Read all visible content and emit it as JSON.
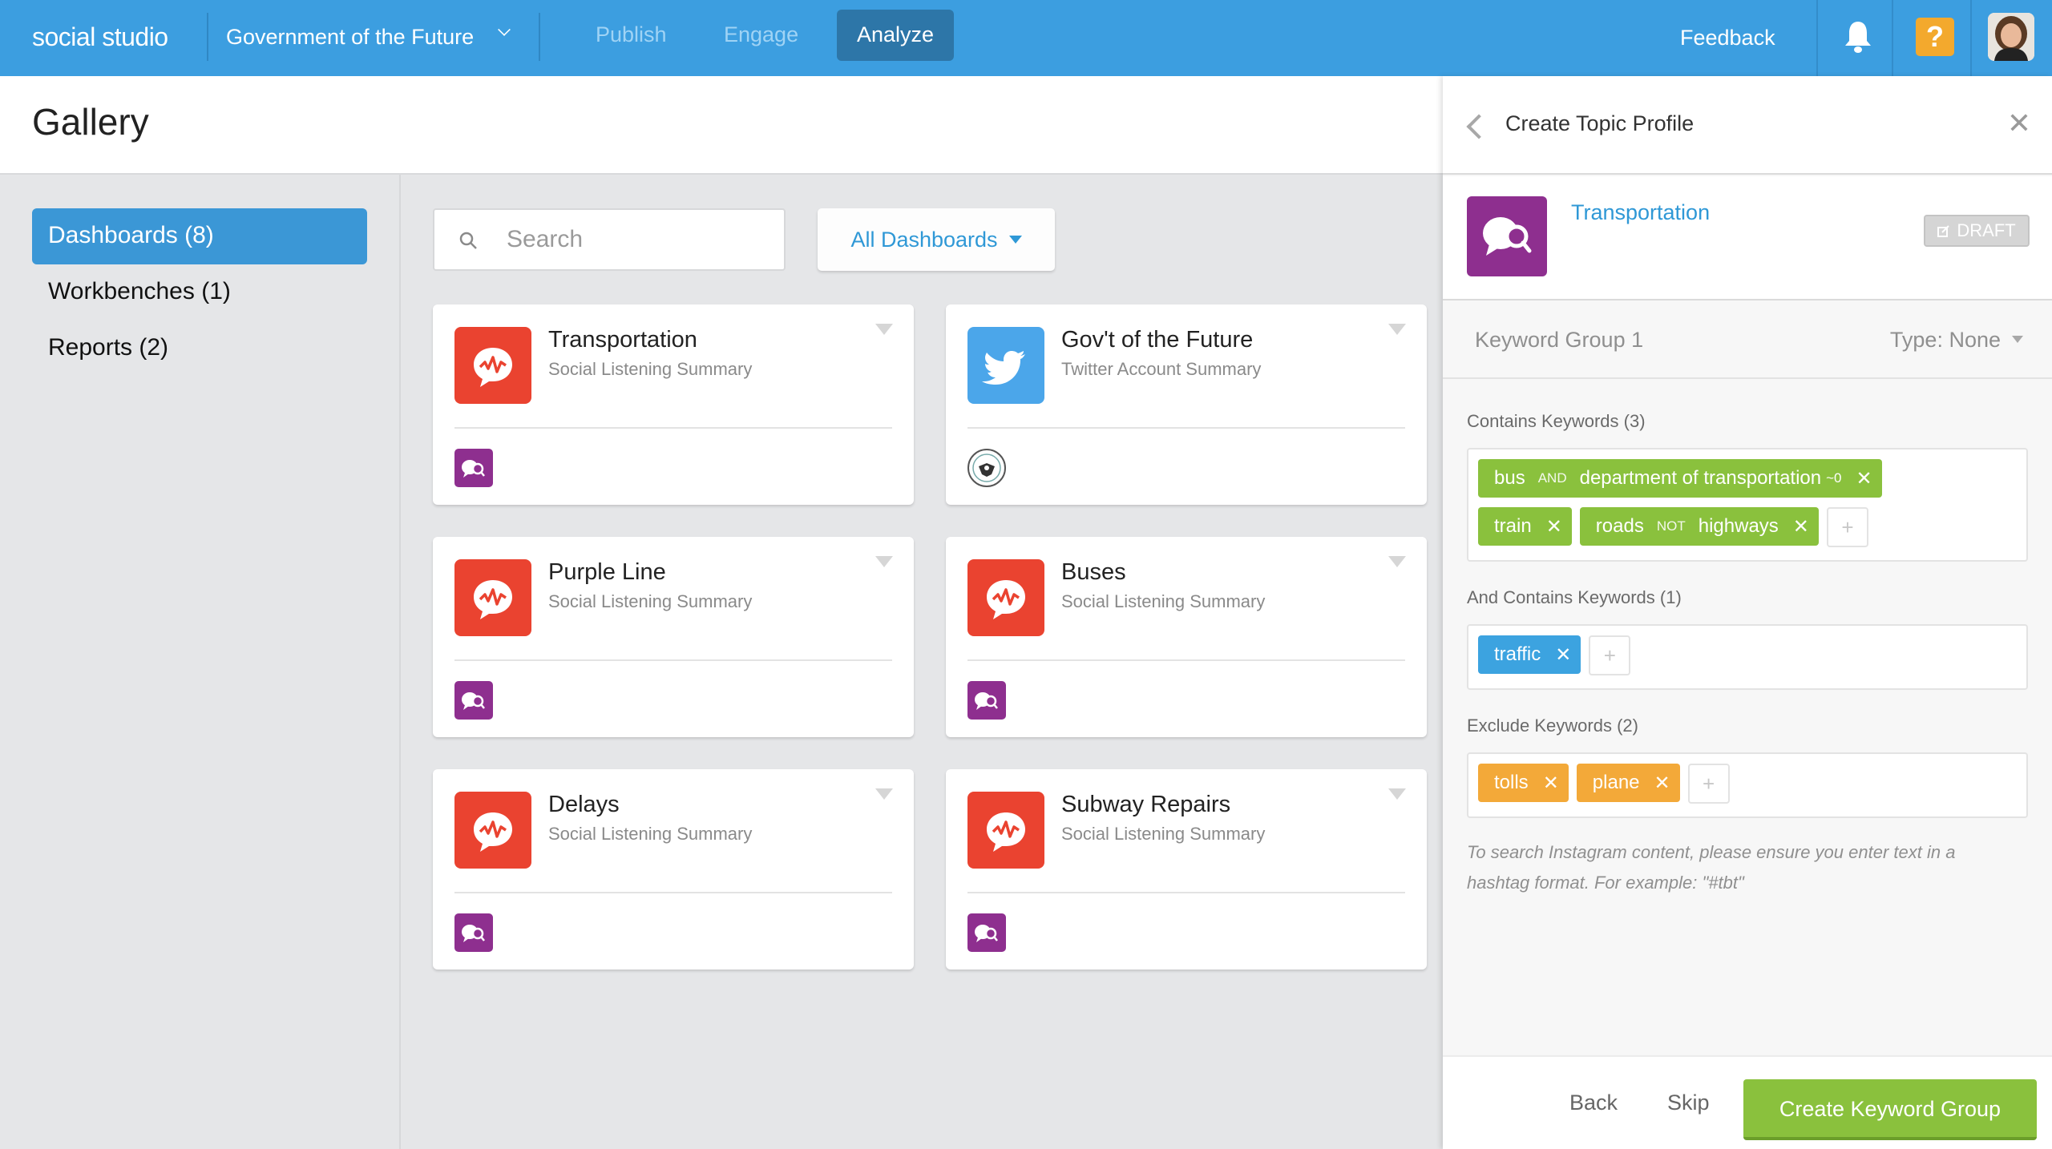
{
  "header": {
    "app_name": "social studio",
    "workspace": "Government of the Future",
    "nav": [
      {
        "label": "Publish",
        "active": false
      },
      {
        "label": "Engage",
        "active": false
      },
      {
        "label": "Analyze",
        "active": true
      }
    ],
    "feedback_label": "Feedback",
    "help_label": "?",
    "colors": {
      "bar": "#3c9ee0",
      "active_tab": "#2d76a8",
      "help": "#f3a92d"
    }
  },
  "page": {
    "title": "Gallery"
  },
  "sidebar": {
    "items": [
      {
        "label": "Dashboards (8)",
        "active": true
      },
      {
        "label": "Workbenches (1)",
        "active": false
      },
      {
        "label": "Reports (2)",
        "active": false
      }
    ]
  },
  "toolbar": {
    "search_placeholder": "Search",
    "search_value": "",
    "filter_label": "All Dashboards"
  },
  "cards": [
    {
      "title": "Transportation",
      "subtitle": "Social Listening Summary",
      "icon": "social-listening-icon",
      "badge": "topic-profile-icon"
    },
    {
      "title": "Gov't of the Future",
      "subtitle": "Twitter Account Summary",
      "icon": "twitter-icon",
      "badge": "department-seal-icon"
    },
    {
      "title": "Purple Line",
      "subtitle": "Social Listening Summary",
      "icon": "social-listening-icon",
      "badge": "topic-profile-icon"
    },
    {
      "title": "Buses",
      "subtitle": "Social Listening Summary",
      "icon": "social-listening-icon",
      "badge": "topic-profile-icon"
    },
    {
      "title": "Delays",
      "subtitle": "Social Listening Summary",
      "icon": "social-listening-icon",
      "badge": "topic-profile-icon"
    },
    {
      "title": "Subway Repairs",
      "subtitle": "Social Listening Summary",
      "icon": "social-listening-icon",
      "badge": "topic-profile-icon"
    }
  ],
  "panel": {
    "title": "Create Topic Profile",
    "profile_name": "Transportation",
    "status_badge": "DRAFT",
    "keyword_group": {
      "name": "Keyword Group 1",
      "type_label": "Type: None"
    },
    "contains": {
      "label": "Contains Keywords (3)",
      "chips": [
        {
          "left": "bus",
          "op": "AND",
          "right": "department of transportation",
          "prox": "~0"
        },
        {
          "left": "train"
        },
        {
          "left": "roads",
          "op": "NOT",
          "right": "highways"
        }
      ]
    },
    "and_contains": {
      "label": "And Contains Keywords (1)",
      "chips": [
        {
          "left": "traffic"
        }
      ]
    },
    "exclude": {
      "label": "Exclude Keywords (2)",
      "chips": [
        {
          "left": "tolls"
        },
        {
          "left": "plane"
        }
      ]
    },
    "hint": "To search Instagram content, please ensure you enter text in a hashtag format. For example: \"#tbt\"",
    "footer": {
      "back": "Back",
      "skip": "Skip",
      "primary": "Create Keyword Group"
    },
    "colors": {
      "contains": "#8ac13d",
      "and_contains": "#3ca3e0",
      "exclude": "#f3a939",
      "primary": "#8ac13d",
      "profile_icon": "#8e2f8f"
    }
  },
  "symbols": {
    "chip_remove": "✕",
    "add": "+",
    "close": "✕"
  }
}
